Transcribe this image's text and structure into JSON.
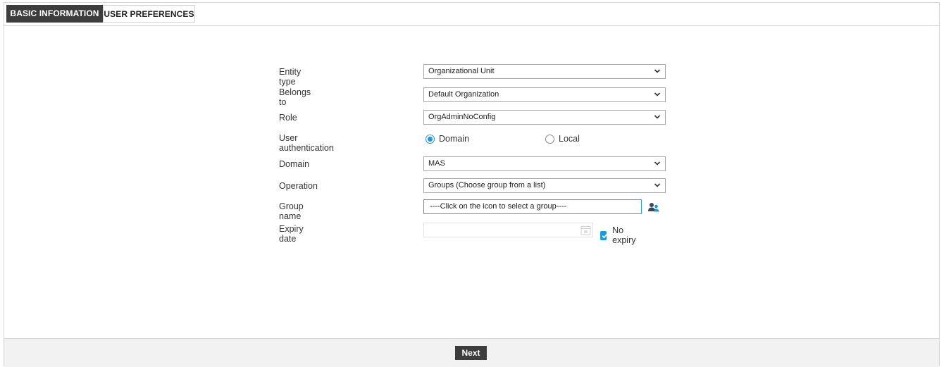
{
  "tabs": [
    {
      "label": "BASIC INFORMATION",
      "active": true
    },
    {
      "label": "USER PREFERENCES",
      "active": false
    }
  ],
  "form": {
    "entity_type": {
      "label": "Entity type",
      "value": "Organizational Unit"
    },
    "belongs_to": {
      "label": "Belongs to",
      "value": "Default Organization"
    },
    "role": {
      "label": "Role",
      "value": "OrgAdminNoConfig"
    },
    "user_authentication": {
      "label": "User authentication",
      "options": [
        {
          "label": "Domain",
          "checked": true
        },
        {
          "label": "Local",
          "checked": false
        }
      ]
    },
    "domain": {
      "label": "Domain",
      "value": "MAS"
    },
    "operation": {
      "label": "Operation",
      "value": "Groups (Choose group from a list)"
    },
    "group_name": {
      "label": "Group name",
      "value": "----Click on the icon to select a group----"
    },
    "expiry_date": {
      "label": "Expiry date",
      "value": "",
      "no_expiry_label": "No expiry",
      "no_expiry_checked": true
    }
  },
  "footer": {
    "next_label": "Next"
  },
  "icons": {
    "dropdown": "chevron-down-icon",
    "group_picker": "users-icon",
    "calendar": "calendar-icon",
    "check": "checkmark-icon"
  },
  "colors": {
    "tab_active_bg": "#3d3d3d",
    "accent": "#1a9ad6",
    "input_focus_border": "#2aa6c9",
    "footer_bg": "#f2f2f2"
  }
}
